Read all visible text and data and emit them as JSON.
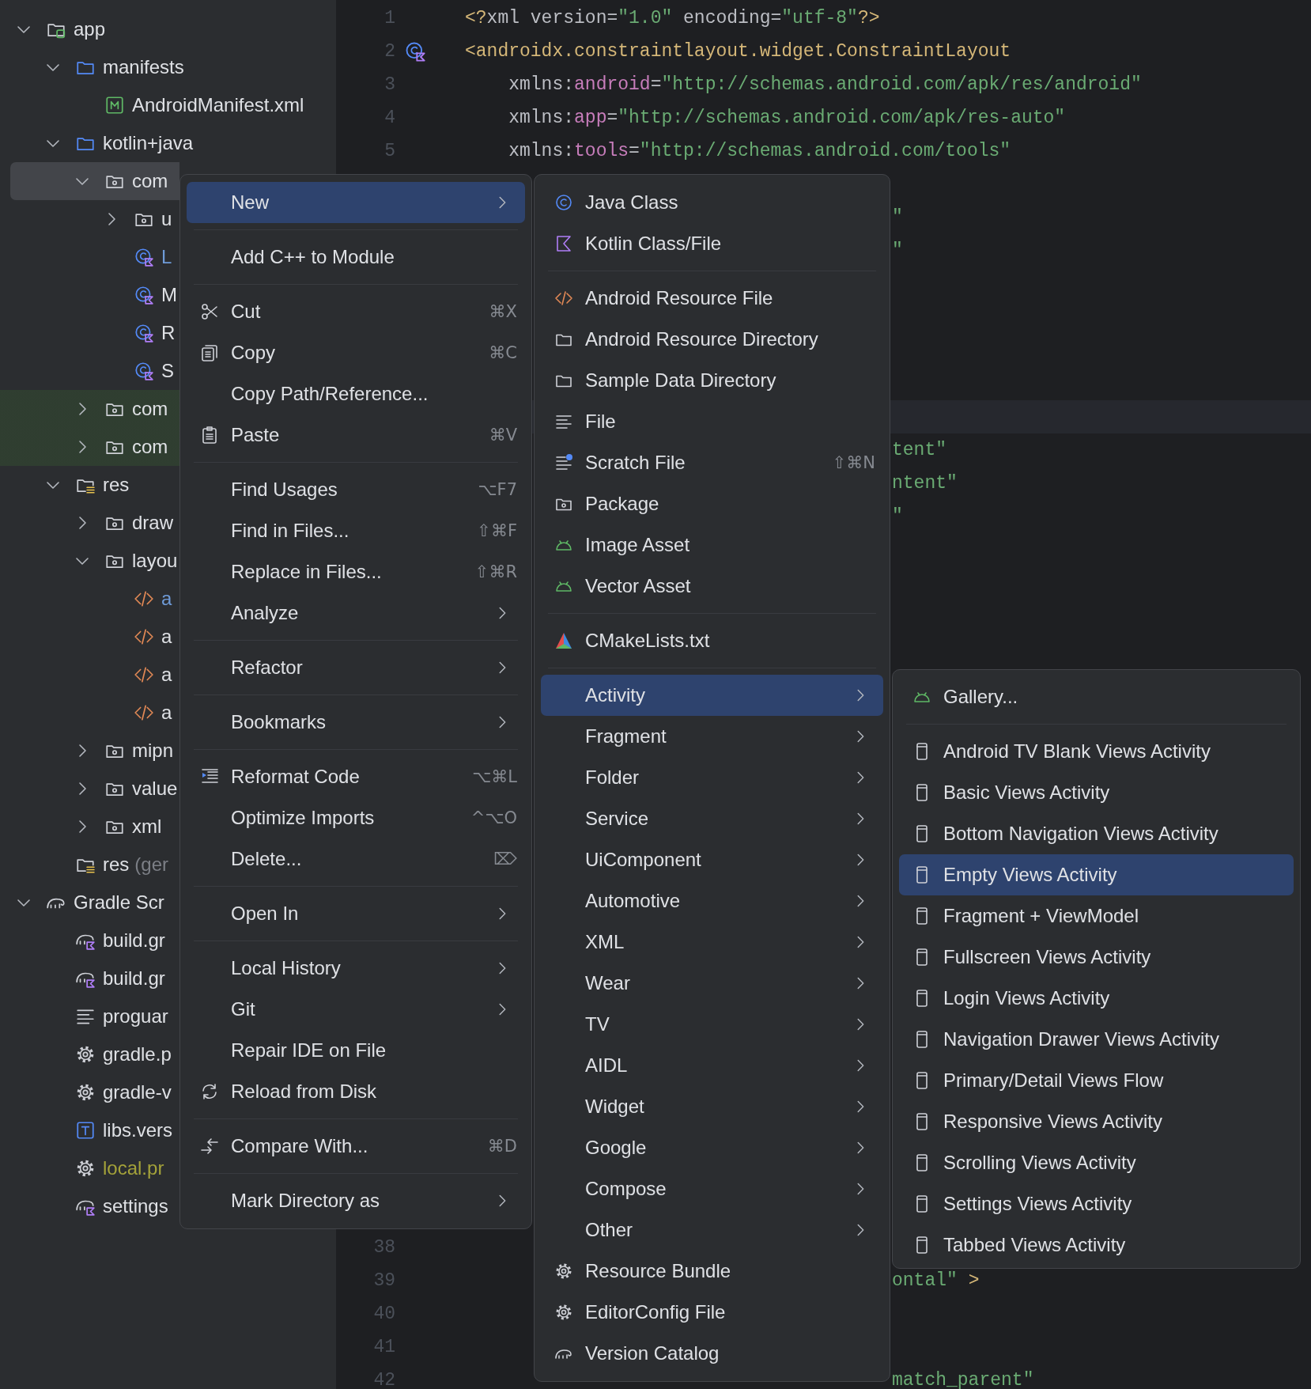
{
  "project_tree": [
    {
      "label": "app",
      "kind": "module",
      "expanded": true,
      "selected": false,
      "highlighted": false,
      "children": [
        {
          "label": "manifests",
          "kind": "source_folder",
          "expanded": true,
          "selected": false,
          "highlighted": false,
          "children": [
            {
              "label": "AndroidManifest.xml",
              "kind": "manifest",
              "selected": false,
              "highlighted": false
            }
          ]
        },
        {
          "label": "kotlin+java",
          "kind": "source_folder",
          "expanded": true,
          "selected": false,
          "highlighted": false,
          "children": [
            {
              "label": "com",
              "kind": "package",
              "expanded": true,
              "selected": true,
              "highlighted": false,
              "children": [
                {
                  "label": "u",
                  "kind": "package",
                  "expanded": false,
                  "selected": false,
                  "highlighted": false
                },
                {
                  "label": "L",
                  "kind": "class",
                  "selected": false,
                  "highlighted": false,
                  "color": "#6f9bd8"
                },
                {
                  "label": "M",
                  "kind": "class",
                  "selected": false,
                  "highlighted": false
                },
                {
                  "label": "R",
                  "kind": "class",
                  "selected": false,
                  "highlighted": false
                },
                {
                  "label": "S",
                  "kind": "class",
                  "selected": false,
                  "highlighted": false
                }
              ]
            },
            {
              "label": "com",
              "kind": "package",
              "expanded": false,
              "selected": false,
              "highlighted": true
            },
            {
              "label": "com",
              "kind": "package",
              "expanded": false,
              "selected": false,
              "highlighted": true
            }
          ]
        },
        {
          "label": "res",
          "kind": "res_folder",
          "expanded": true,
          "selected": false,
          "highlighted": false,
          "children": [
            {
              "label": "draw",
              "kind": "package",
              "expanded": false,
              "selected": false,
              "highlighted": false
            },
            {
              "label": "layou",
              "kind": "package",
              "expanded": true,
              "selected": false,
              "highlighted": false,
              "children": [
                {
                  "label": "a",
                  "kind": "layout_file",
                  "selected": false,
                  "highlighted": false,
                  "color": "#6f9bd8"
                },
                {
                  "label": "a",
                  "kind": "layout_file",
                  "selected": false,
                  "highlighted": false
                },
                {
                  "label": "a",
                  "kind": "layout_file",
                  "selected": false,
                  "highlighted": false
                },
                {
                  "label": "a",
                  "kind": "layout_file",
                  "selected": false,
                  "highlighted": false
                }
              ]
            },
            {
              "label": "mipn",
              "kind": "package",
              "expanded": false,
              "selected": false,
              "highlighted": false
            },
            {
              "label": "value",
              "kind": "package",
              "expanded": false,
              "selected": false,
              "highlighted": false
            },
            {
              "label": "xml",
              "kind": "package",
              "expanded": false,
              "selected": false,
              "highlighted": false
            }
          ]
        },
        {
          "label": "res",
          "note": "(ger",
          "kind": "res_folder",
          "selected": false,
          "highlighted": false
        }
      ]
    },
    {
      "label": "Gradle Scr",
      "kind": "gradle_group",
      "expanded": true,
      "selected": false,
      "highlighted": false,
      "children": [
        {
          "label": "build.gr",
          "kind": "gradle_script",
          "selected": false,
          "highlighted": false
        },
        {
          "label": "build.gr",
          "kind": "gradle_script",
          "selected": false,
          "highlighted": false
        },
        {
          "label": "proguar",
          "kind": "text_file",
          "selected": false,
          "highlighted": false
        },
        {
          "label": "gradle.p",
          "kind": "properties_file",
          "selected": false,
          "highlighted": false
        },
        {
          "label": "gradle-v",
          "kind": "properties_file",
          "selected": false,
          "highlighted": false
        },
        {
          "label": "libs.vers",
          "kind": "toml_file",
          "selected": false,
          "highlighted": false
        },
        {
          "label": "local.pr",
          "kind": "properties_file",
          "selected": false,
          "highlighted": false,
          "color": "#a4a23a"
        },
        {
          "label": "settings",
          "kind": "gradle_script",
          "selected": false,
          "highlighted": false
        }
      ]
    }
  ],
  "editor": {
    "lines": [
      {
        "number": "1",
        "kind": "full",
        "current": false,
        "segments": [
          {
            "color": "#d5b778",
            "text": "<?"
          },
          {
            "color": "#bcbec4",
            "text": "xml version="
          },
          {
            "color": "#6aab73",
            "text": "\"1.0\""
          },
          {
            "color": "#bcbec4",
            "text": " encoding="
          },
          {
            "color": "#6aab73",
            "text": "\"utf-8\""
          },
          {
            "color": "#d5b778",
            "text": "?>"
          }
        ]
      },
      {
        "number": "2",
        "kind": "full",
        "current": false,
        "marker": true,
        "segments": [
          {
            "color": "#d5b778",
            "text": "<androidx.constraintlayout.widget.ConstraintLayout"
          }
        ]
      },
      {
        "number": "3",
        "kind": "full",
        "current": false,
        "segments": [
          {
            "color": "#bcbec4",
            "text": "    xmlns:"
          },
          {
            "color": "#c77dbb",
            "text": "android"
          },
          {
            "color": "#bcbec4",
            "text": "="
          },
          {
            "color": "#6aab73",
            "text": "\"http://schemas.android.com/apk/res/android\""
          }
        ]
      },
      {
        "number": "4",
        "kind": "full",
        "current": false,
        "segments": [
          {
            "color": "#bcbec4",
            "text": "    xmlns:"
          },
          {
            "color": "#c77dbb",
            "text": "app"
          },
          {
            "color": "#bcbec4",
            "text": "="
          },
          {
            "color": "#6aab73",
            "text": "\"http://schemas.android.com/apk/res-auto\""
          }
        ]
      },
      {
        "number": "5",
        "kind": "full",
        "current": false,
        "segments": [
          {
            "color": "#bcbec4",
            "text": "    xmlns:"
          },
          {
            "color": "#c77dbb",
            "text": "tools"
          },
          {
            "color": "#bcbec4",
            "text": "="
          },
          {
            "color": "#6aab73",
            "text": "\"http://schemas.android.com/tools\""
          }
        ]
      },
      {
        "kind": "blank",
        "current": false
      },
      {
        "kind": "fragment",
        "current": false,
        "segments": [
          {
            "color": "#6aab73",
            "text": "\""
          }
        ]
      },
      {
        "kind": "fragment",
        "current": false,
        "segments": [
          {
            "color": "#6aab73",
            "text": "\""
          }
        ]
      },
      {
        "kind": "blank",
        "current": false
      },
      {
        "kind": "blank",
        "current": false
      },
      {
        "kind": "blank",
        "current": false
      },
      {
        "kind": "blank",
        "current": false
      },
      {
        "kind": "blank",
        "current": true
      },
      {
        "kind": "fragment",
        "current": false,
        "segments": [
          {
            "color": "#6aab73",
            "text": "tent\""
          }
        ]
      },
      {
        "kind": "fragment",
        "current": false,
        "segments": [
          {
            "color": "#6aab73",
            "text": "ntent\""
          }
        ]
      },
      {
        "kind": "fragment",
        "current": false,
        "segments": [
          {
            "color": "#6aab73",
            "text": "\""
          }
        ]
      },
      {
        "kind": "blank",
        "current": false
      },
      {
        "kind": "blank",
        "current": false
      },
      {
        "kind": "blank",
        "current": false
      },
      {
        "kind": "blank",
        "current": false
      },
      {
        "kind": "blank",
        "current": false
      },
      {
        "kind": "blank",
        "current": false
      },
      {
        "kind": "blank",
        "current": false
      },
      {
        "kind": "blank",
        "current": false
      },
      {
        "kind": "blank",
        "current": false
      },
      {
        "kind": "blank",
        "current": false
      },
      {
        "kind": "blank",
        "current": false
      },
      {
        "kind": "blank",
        "current": false
      },
      {
        "kind": "blank",
        "current": false
      },
      {
        "kind": "blank",
        "current": false
      },
      {
        "kind": "blank",
        "current": false
      },
      {
        "kind": "blank",
        "current": false
      },
      {
        "kind": "blank",
        "current": false
      },
      {
        "kind": "blank",
        "current": false
      },
      {
        "kind": "blank",
        "current": false
      },
      {
        "kind": "blank",
        "current": false
      },
      {
        "kind": "blank",
        "current": false
      },
      {
        "number": "38",
        "kind": "blank",
        "current": false
      },
      {
        "number": "39",
        "kind": "fragment",
        "current": false,
        "segments": [
          {
            "color": "#6aab73",
            "text": "ontal\""
          },
          {
            "color": "#d5b778",
            "text": " >"
          }
        ]
      },
      {
        "number": "40",
        "kind": "blank",
        "current": false
      },
      {
        "number": "41",
        "kind": "blank",
        "current": false
      },
      {
        "number": "42",
        "kind": "fragment",
        "current": false,
        "segments": [
          {
            "color": "#6aab73",
            "text": "match_parent\""
          }
        ]
      }
    ]
  },
  "menus": [
    {
      "items": [
        {
          "kind": "plain",
          "label": "New",
          "submenu": true,
          "selected": true
        },
        {
          "kind": "separator"
        },
        {
          "kind": "plain",
          "label": "Add C++ to Module",
          "submenu": false,
          "selected": false
        },
        {
          "kind": "separator"
        },
        {
          "kind": "scissors",
          "label": "Cut",
          "shortcut": "⌘X",
          "submenu": false,
          "selected": false
        },
        {
          "kind": "copy",
          "label": "Copy",
          "shortcut": "⌘C",
          "submenu": false,
          "selected": false
        },
        {
          "kind": "plain",
          "label": "Copy Path/Reference...",
          "submenu": false,
          "selected": false
        },
        {
          "kind": "clipboard",
          "label": "Paste",
          "shortcut": "⌘V",
          "submenu": false,
          "selected": false
        },
        {
          "kind": "separator"
        },
        {
          "kind": "plain",
          "label": "Find Usages",
          "shortcut": "⌥F7",
          "submenu": false,
          "selected": false
        },
        {
          "kind": "plain",
          "label": "Find in Files...",
          "shortcut": "⇧⌘F",
          "submenu": false,
          "selected": false
        },
        {
          "kind": "plain",
          "label": "Replace in Files...",
          "shortcut": "⇧⌘R",
          "submenu": false,
          "selected": false
        },
        {
          "kind": "plain",
          "label": "Analyze",
          "submenu": true,
          "selected": false
        },
        {
          "kind": "separator"
        },
        {
          "kind": "plain",
          "label": "Refactor",
          "submenu": true,
          "selected": false
        },
        {
          "kind": "separator"
        },
        {
          "kind": "plain",
          "label": "Bookmarks",
          "submenu": true,
          "selected": false
        },
        {
          "kind": "separator"
        },
        {
          "kind": "reformat",
          "label": "Reformat Code",
          "shortcut": "⌥⌘L",
          "submenu": false,
          "selected": false
        },
        {
          "kind": "plain",
          "label": "Optimize Imports",
          "shortcut": "^⌥O",
          "submenu": false,
          "selected": false
        },
        {
          "kind": "plain",
          "label": "Delete...",
          "shortcut": "⌦",
          "submenu": false,
          "selected": false
        },
        {
          "kind": "separator"
        },
        {
          "kind": "plain",
          "label": "Open In",
          "submenu": true,
          "selected": false
        },
        {
          "kind": "separator"
        },
        {
          "kind": "plain",
          "label": "Local History",
          "submenu": true,
          "selected": false
        },
        {
          "kind": "plain",
          "label": "Git",
          "submenu": true,
          "selected": false
        },
        {
          "kind": "plain",
          "label": "Repair IDE on File",
          "submenu": false,
          "selected": false
        },
        {
          "kind": "reload",
          "label": "Reload from Disk",
          "submenu": false,
          "selected": false
        },
        {
          "kind": "separator"
        },
        {
          "kind": "compare",
          "label": "Compare With...",
          "shortcut": "⌘D",
          "submenu": false,
          "selected": false
        },
        {
          "kind": "separator"
        },
        {
          "kind": "plain",
          "label": "Mark Directory as",
          "submenu": true,
          "selected": false
        }
      ]
    },
    {
      "items": [
        {
          "kind": "java_class",
          "label": "Java Class",
          "submenu": false,
          "selected": false
        },
        {
          "kind": "kotlin_file",
          "label": "Kotlin Class/File",
          "submenu": false,
          "selected": false
        },
        {
          "kind": "separator"
        },
        {
          "kind": "xml_file",
          "label": "Android Resource File",
          "submenu": false,
          "selected": false
        },
        {
          "kind": "folder",
          "label": "Android Resource Directory",
          "submenu": false,
          "selected": false
        },
        {
          "kind": "folder",
          "label": "Sample Data Directory",
          "submenu": false,
          "selected": false
        },
        {
          "kind": "lines",
          "label": "File",
          "submenu": false,
          "selected": false
        },
        {
          "kind": "scratch",
          "label": "Scratch File",
          "shortcut": "⇧⌘N",
          "submenu": false,
          "selected": false
        },
        {
          "kind": "package",
          "label": "Package",
          "submenu": false,
          "selected": false
        },
        {
          "kind": "android",
          "label": "Image Asset",
          "submenu": false,
          "selected": false
        },
        {
          "kind": "android",
          "label": "Vector Asset",
          "submenu": false,
          "selected": false
        },
        {
          "kind": "separator"
        },
        {
          "kind": "cmake",
          "label": "CMakeLists.txt",
          "submenu": false,
          "selected": false
        },
        {
          "kind": "separator"
        },
        {
          "kind": "plain",
          "label": "Activity",
          "submenu": true,
          "selected": true
        },
        {
          "kind": "plain",
          "label": "Fragment",
          "submenu": true,
          "selected": false
        },
        {
          "kind": "plain",
          "label": "Folder",
          "submenu": true,
          "selected": false
        },
        {
          "kind": "plain",
          "label": "Service",
          "submenu": true,
          "selected": false
        },
        {
          "kind": "plain",
          "label": "UiComponent",
          "submenu": true,
          "selected": false
        },
        {
          "kind": "plain",
          "label": "Automotive",
          "submenu": true,
          "selected": false
        },
        {
          "kind": "plain",
          "label": "XML",
          "submenu": true,
          "selected": false
        },
        {
          "kind": "plain",
          "label": "Wear",
          "submenu": true,
          "selected": false
        },
        {
          "kind": "plain",
          "label": "TV",
          "submenu": true,
          "selected": false
        },
        {
          "kind": "plain",
          "label": "AIDL",
          "submenu": true,
          "selected": false
        },
        {
          "kind": "plain",
          "label": "Widget",
          "submenu": true,
          "selected": false
        },
        {
          "kind": "plain",
          "label": "Google",
          "submenu": true,
          "selected": false
        },
        {
          "kind": "plain",
          "label": "Compose",
          "submenu": true,
          "selected": false
        },
        {
          "kind": "plain",
          "label": "Other",
          "submenu": true,
          "selected": false
        },
        {
          "kind": "gear",
          "label": "Resource Bundle",
          "submenu": false,
          "selected": false
        },
        {
          "kind": "gear",
          "label": "EditorConfig File",
          "submenu": false,
          "selected": false
        },
        {
          "kind": "gradle",
          "label": "Version Catalog",
          "submenu": false,
          "selected": false
        }
      ]
    },
    {
      "items": [
        {
          "kind": "android",
          "label": "Gallery...",
          "submenu": false,
          "selected": false
        },
        {
          "kind": "separator"
        },
        {
          "kind": "phone",
          "label": "Android TV Blank Views Activity",
          "submenu": false,
          "selected": false
        },
        {
          "kind": "phone",
          "label": "Basic Views Activity",
          "submenu": false,
          "selected": false
        },
        {
          "kind": "phone",
          "label": "Bottom Navigation Views Activity",
          "submenu": false,
          "selected": false
        },
        {
          "kind": "phone",
          "label": "Empty Views Activity",
          "submenu": false,
          "selected": true
        },
        {
          "kind": "phone",
          "label": "Fragment + ViewModel",
          "submenu": false,
          "selected": false
        },
        {
          "kind": "phone",
          "label": "Fullscreen Views Activity",
          "submenu": false,
          "selected": false
        },
        {
          "kind": "phone",
          "label": "Login Views Activity",
          "submenu": false,
          "selected": false
        },
        {
          "kind": "phone",
          "label": "Navigation Drawer Views Activity",
          "submenu": false,
          "selected": false
        },
        {
          "kind": "phone",
          "label": "Primary/Detail Views Flow",
          "submenu": false,
          "selected": false
        },
        {
          "kind": "phone",
          "label": "Responsive Views Activity",
          "submenu": false,
          "selected": false
        },
        {
          "kind": "phone",
          "label": "Scrolling Views Activity",
          "submenu": false,
          "selected": false
        },
        {
          "kind": "phone",
          "label": "Settings Views Activity",
          "submenu": false,
          "selected": false
        },
        {
          "kind": "phone",
          "label": "Tabbed Views Activity",
          "submenu": false,
          "selected": false
        }
      ]
    }
  ]
}
